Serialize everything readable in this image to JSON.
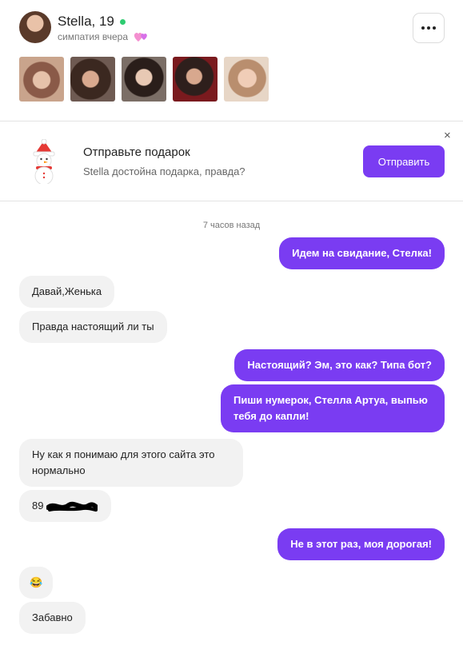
{
  "profile": {
    "name": "Stella, 19",
    "subtitle": "симпатия вчера",
    "more_label": "⋯"
  },
  "photos": [
    "photo-1",
    "photo-2",
    "photo-3",
    "photo-4",
    "photo-5"
  ],
  "gift_banner": {
    "title": "Отправьте подарок",
    "subtitle": "Stella достойна подарка, правда?",
    "send_label": "Отправить",
    "close_label": "×"
  },
  "chat": {
    "timestamp": "7 часов назад",
    "messages": [
      {
        "side": "out",
        "text": "Идем на свидание, Стелка!"
      },
      {
        "side": "in",
        "text": "Давай,Женька"
      },
      {
        "side": "in",
        "text": "Правда настоящий ли ты"
      },
      {
        "side": "out",
        "text": "Настоящий? Эм, это как? Типа бот?"
      },
      {
        "side": "out",
        "text": "Пиши нумерок, Стелла Артуа, выпью тебя до капли!"
      },
      {
        "side": "in",
        "text": "Ну как я понимаю для этого сайта это нормально"
      },
      {
        "side": "in",
        "text": "89"
      },
      {
        "side": "out",
        "text": "Не в этот раз, моя дорогая!"
      },
      {
        "side": "in",
        "text": "😂"
      },
      {
        "side": "in",
        "text": "Забавно"
      }
    ]
  },
  "colors": {
    "accent": "#7a3cf2",
    "incoming_bubble": "#f2f2f2",
    "online": "#2ecc71"
  }
}
